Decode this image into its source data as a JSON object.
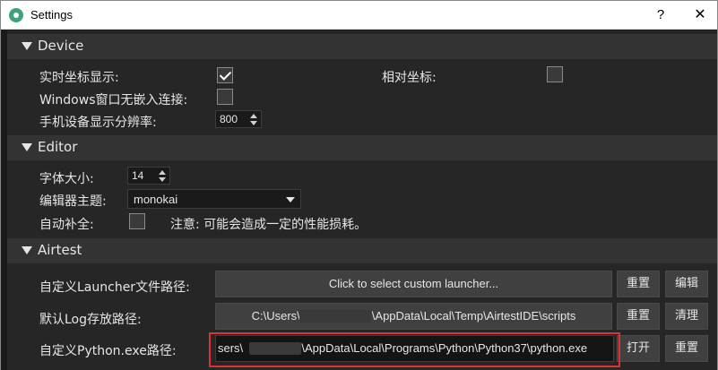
{
  "window": {
    "title": "Settings",
    "help_label": "?",
    "close_label": "✕",
    "icon": "settings-gear-icon"
  },
  "device": {
    "header": "Device",
    "realtime_coords_label": "实时坐标显示:",
    "realtime_coords_checked": true,
    "relative_coords_label": "相对坐标:",
    "relative_coords_checked": false,
    "windows_embed_label": "Windows窗口无嵌入连接:",
    "windows_embed_checked": false,
    "resolution_label": "手机设备显示分辨率:",
    "resolution_value": "800"
  },
  "editor": {
    "header": "Editor",
    "font_size_label": "字体大小:",
    "font_size_value": "14",
    "theme_label": "编辑器主题:",
    "theme_value": "monokai",
    "autocomplete_label": "自动补全:",
    "autocomplete_checked": false,
    "autocomplete_note": "注意: 可能会造成一定的性能损耗。"
  },
  "airtest": {
    "header": "Airtest",
    "launcher_label": "自定义Launcher文件路径:",
    "launcher_button": "Click to select custom launcher...",
    "launcher_reset": "重置",
    "launcher_edit": "编辑",
    "log_label": "默认Log存放路径:",
    "log_path_prefix": "C:\\Users\\",
    "log_path_suffix": "\\AppData\\Local\\Temp\\AirtestIDE\\scripts",
    "log_reset": "重置",
    "log_clear": "清理",
    "python_label": "自定义Python.exe路径:",
    "python_path_prefix": "sers\\",
    "python_path_suffix": "n\\AppData\\Local\\Programs\\Python\\Python37\\python.exe",
    "python_open": "打开",
    "python_reset": "重置"
  },
  "colors": {
    "background": "#262626",
    "section_header": "#333333",
    "text": "#e6e6e6",
    "highlight": "#e03030"
  }
}
